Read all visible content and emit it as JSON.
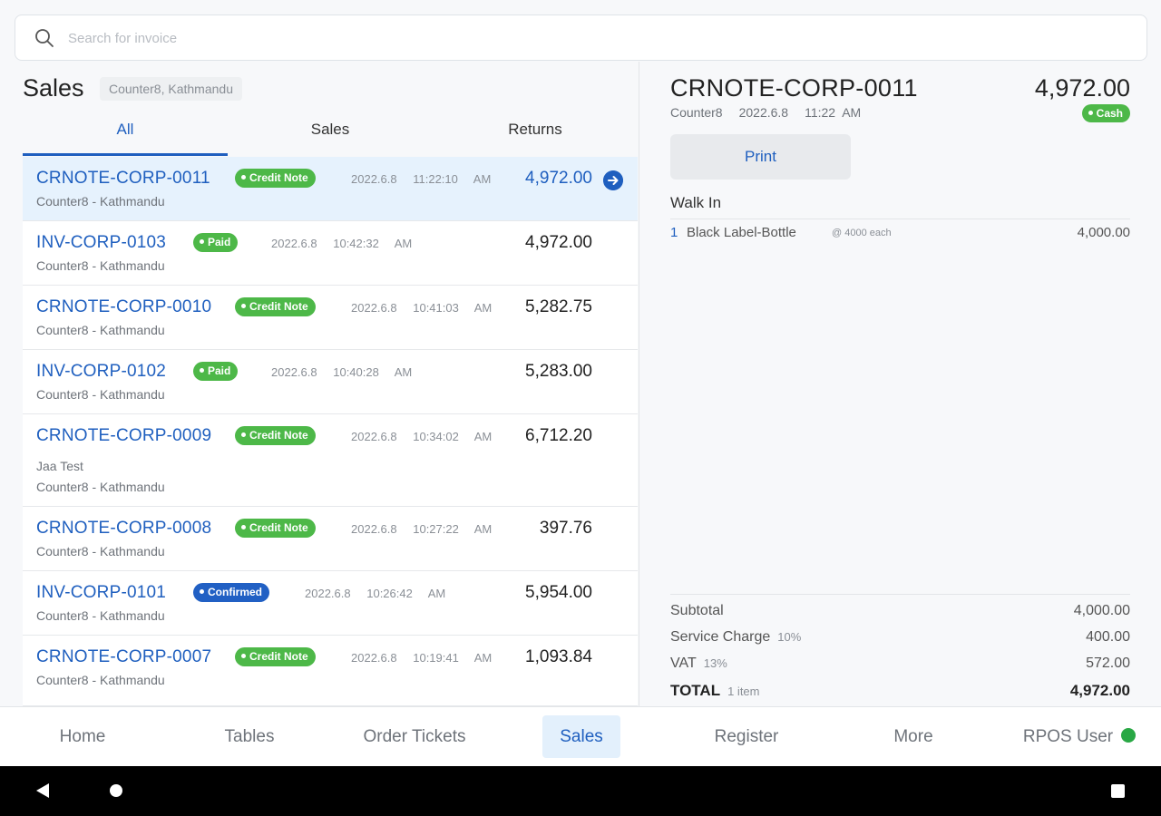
{
  "search": {
    "placeholder": "Search for invoice"
  },
  "left": {
    "title": "Sales",
    "location": "Counter8, Kathmandu",
    "tabs": [
      {
        "label": "All",
        "active": true
      },
      {
        "label": "Sales",
        "active": false
      },
      {
        "label": "Returns",
        "active": false
      }
    ],
    "rows": [
      {
        "invoice": "CRNOTE-CORP-0011",
        "badge": "Credit Note",
        "date": "2022.6.8",
        "time": "11:22:10 AM",
        "amount": "4,972.00",
        "note": "",
        "sub": "Counter8 - Kathmandu"
      },
      {
        "invoice": "INV-CORP-0103",
        "badge": "Paid",
        "date": "2022.6.8",
        "time": "10:42:32 AM",
        "amount": "4,972.00",
        "note": "",
        "sub": "Counter8 - Kathmandu"
      },
      {
        "invoice": "CRNOTE-CORP-0010",
        "badge": "Credit Note",
        "date": "2022.6.8",
        "time": "10:41:03 AM",
        "amount": "5,282.75",
        "note": "",
        "sub": "Counter8 - Kathmandu"
      },
      {
        "invoice": "INV-CORP-0102",
        "badge": "Paid",
        "date": "2022.6.8",
        "time": "10:40:28 AM",
        "amount": "5,283.00",
        "note": "",
        "sub": "Counter8 - Kathmandu"
      },
      {
        "invoice": "CRNOTE-CORP-0009",
        "badge": "Credit Note",
        "date": "2022.6.8",
        "time": "10:34:02 AM",
        "amount": "6,712.20",
        "note": "Jaa Test",
        "sub": "Counter8 - Kathmandu"
      },
      {
        "invoice": "CRNOTE-CORP-0008",
        "badge": "Credit Note",
        "date": "2022.6.8",
        "time": "10:27:22 AM",
        "amount": "397.76",
        "note": "",
        "sub": "Counter8 - Kathmandu"
      },
      {
        "invoice": "INV-CORP-0101",
        "badge": "Confirmed",
        "date": "2022.6.8",
        "time": "10:26:42 AM",
        "amount": "5,954.00",
        "note": "",
        "sub": "Counter8 - Kathmandu"
      },
      {
        "invoice": "CRNOTE-CORP-0007",
        "badge": "Credit Note",
        "date": "2022.6.8",
        "time": "10:19:41 AM",
        "amount": "1,093.84",
        "note": "",
        "sub": "Counter8 - Kathmandu"
      }
    ]
  },
  "detail": {
    "title": "CRNOTE-CORP-0011",
    "counter": "Counter8",
    "date": "2022.6.8",
    "time": "11:22 AM",
    "total": "4,972.00",
    "payment_badge": "Cash",
    "print_label": "Print",
    "customer": "Walk In",
    "items": [
      {
        "qty": "1",
        "name": "Black Label-Bottle",
        "each": "@ 4000 each",
        "amount": "4,000.00"
      }
    ],
    "subtotal_label": "Subtotal",
    "subtotal": "4,000.00",
    "service_label": "Service Charge",
    "service_pct": "10%",
    "service": "400.00",
    "vat_label": "VAT",
    "vat_pct": "13%",
    "vat": "572.00",
    "total_label": "TOTAL",
    "total_items": "1 item",
    "grand_total": "4,972.00"
  },
  "nav": {
    "items": [
      {
        "label": "Home",
        "active": false
      },
      {
        "label": "Tables",
        "active": false
      },
      {
        "label": "Order Tickets",
        "active": false
      },
      {
        "label": "Sales",
        "active": true
      },
      {
        "label": "Register",
        "active": false
      },
      {
        "label": "More",
        "active": false
      }
    ],
    "user": "RPOS User"
  },
  "colors": {
    "accent": "#1f5fbf",
    "green": "#4db848",
    "confirmed": "#2160c4",
    "online": "#29a845"
  }
}
